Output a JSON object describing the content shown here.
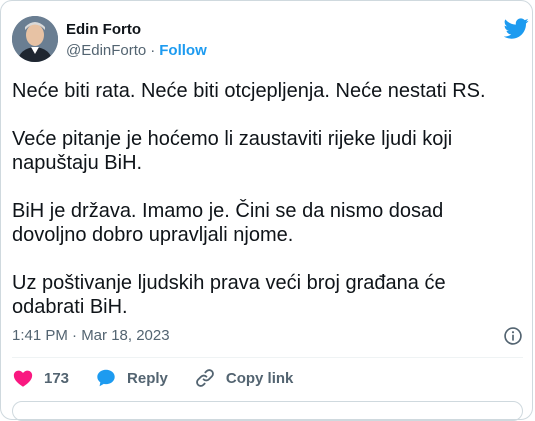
{
  "author": {
    "name": "Edin Forto",
    "handle": "@EdinForto",
    "separator": "·",
    "follow_label": "Follow"
  },
  "tweet": {
    "paragraphs": [
      "Neće biti rata. Neće biti otcjepljenja. Neće nestati RS.",
      "Veće pitanje je hoćemo li zaustaviti rijeke ljudi koji napuštaju BiH.",
      "BiH je država. Imamo je. Čini se da nismo dosad dovoljno dobro upravljali njome.",
      "Uz poštivanje ljudskih prava veći broj građana će odabrati BiH."
    ],
    "timestamp": "1:41 PM · Mar 18, 2023"
  },
  "actions": {
    "likes": "173",
    "reply_label": "Reply",
    "copy_link_label": "Copy link"
  },
  "icons": {
    "brand": "twitter-bird-icon",
    "info": "info-icon",
    "like": "heart-icon",
    "reply": "speech-bubble-icon",
    "copy": "link-icon"
  },
  "colors": {
    "twitter_blue": "#1d9bf0",
    "like_red": "#f91880",
    "text_primary": "#0f1419",
    "text_secondary": "#536471"
  }
}
